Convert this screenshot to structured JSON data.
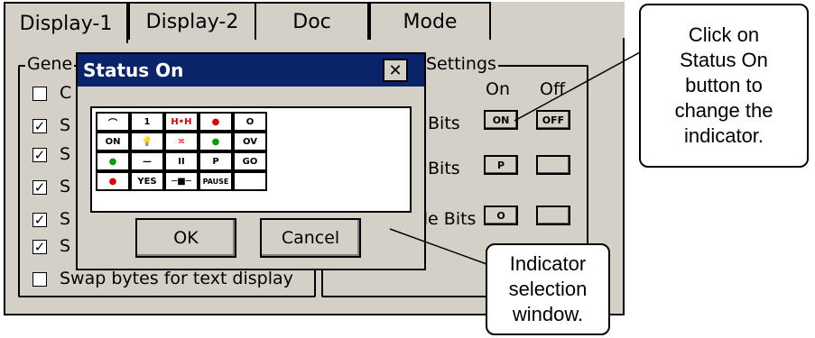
{
  "tabs": [
    "Display-1",
    "Display-2",
    "Doc",
    "Mode"
  ],
  "group_general": {
    "label": "Gene",
    "checkboxes": [
      {
        "label": "C",
        "checked": false
      },
      {
        "label": "S",
        "checked": true
      },
      {
        "label": "S",
        "checked": true
      },
      {
        "label": "S",
        "checked": true
      },
      {
        "label": "S",
        "checked": true
      },
      {
        "label": "S",
        "checked": true
      },
      {
        "label": "Swap bytes for text display",
        "checked": false
      }
    ]
  },
  "group_settings": {
    "label": "Settings",
    "col_on": "On",
    "col_off": "Off",
    "rows": [
      {
        "label": "Bits",
        "on": "ON",
        "off": "OFF"
      },
      {
        "label": "Bits",
        "on": "P",
        "off": ""
      },
      {
        "label": "de Bits",
        "on": "O",
        "off": ""
      }
    ]
  },
  "popup": {
    "title": "Status On",
    "close": "✕",
    "grid": [
      [
        "⌒",
        "1",
        "H•H",
        "●",
        "O"
      ],
      [
        "ON",
        "💡",
        "≍",
        "●",
        "OV"
      ],
      [
        "●",
        "—",
        "II",
        "P",
        "GO"
      ],
      [
        "●",
        "YES",
        "─■─",
        "PAUSE",
        ""
      ]
    ],
    "ok": "OK",
    "cancel": "Cancel"
  },
  "callouts": {
    "top": "Click on Status On button to change the indicator.",
    "bottom": "Indicator selection window."
  },
  "colors": {
    "titlebar": "#0a246a",
    "panel": "#d4d0c8",
    "red": "#e00000",
    "green": "#00a000"
  }
}
